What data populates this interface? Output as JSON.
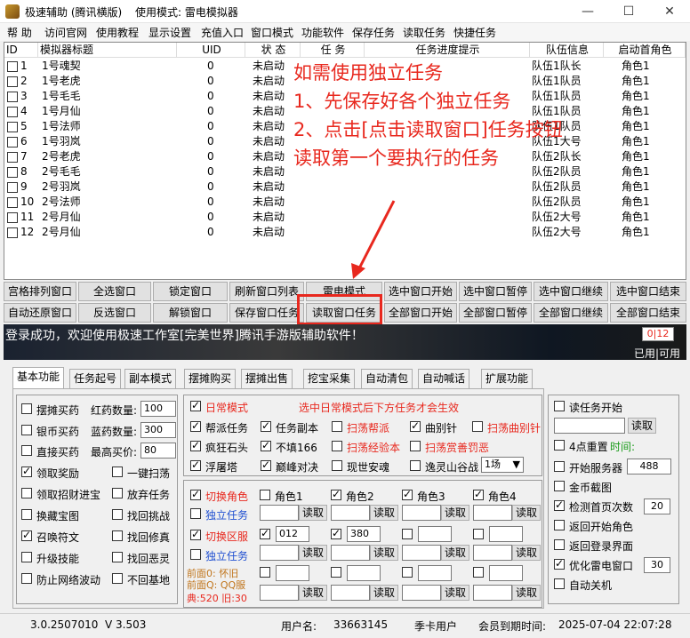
{
  "window": {
    "app_title": "极速辅助 (腾讯横版)",
    "mode_label": "使用模式: 雷电模拟器",
    "min": "—",
    "max": "☐",
    "close": "✕"
  },
  "menu": [
    "帮 助",
    "访问官网",
    "使用教程",
    "显示设置",
    "充值入口",
    "窗口模式",
    "功能软件",
    "保存任务",
    "读取任务",
    "快捷任务"
  ],
  "list": {
    "headers": [
      "ID",
      "模拟器标题",
      "UID",
      "状 态",
      "任 务",
      "任务进度提示",
      "队伍信息",
      "启动首角色"
    ],
    "rows": [
      {
        "id": "1",
        "title": "1号魂契",
        "uid": "0",
        "status": "未启动",
        "team": "队伍1队长",
        "role": "角色1"
      },
      {
        "id": "2",
        "title": "1号老虎",
        "uid": "0",
        "status": "未启动",
        "team": "队伍1队员",
        "role": "角色1"
      },
      {
        "id": "3",
        "title": "1号毛毛",
        "uid": "0",
        "status": "未启动",
        "team": "队伍1队员",
        "role": "角色1"
      },
      {
        "id": "4",
        "title": "1号月仙",
        "uid": "0",
        "status": "未启动",
        "team": "队伍1队员",
        "role": "角色1"
      },
      {
        "id": "5",
        "title": "1号法师",
        "uid": "0",
        "status": "未启动",
        "team": "队伍1队员",
        "role": "角色1"
      },
      {
        "id": "6",
        "title": "1号羽岚",
        "uid": "0",
        "status": "未启动",
        "team": "队伍1大号",
        "role": "角色1"
      },
      {
        "id": "7",
        "title": "2号老虎",
        "uid": "0",
        "status": "未启动",
        "team": "队伍2队长",
        "role": "角色1"
      },
      {
        "id": "8",
        "title": "2号毛毛",
        "uid": "0",
        "status": "未启动",
        "team": "队伍2队员",
        "role": "角色1"
      },
      {
        "id": "9",
        "title": "2号羽岚",
        "uid": "0",
        "status": "未启动",
        "team": "队伍2队员",
        "role": "角色1"
      },
      {
        "id": "10",
        "title": "2号法师",
        "uid": "0",
        "status": "未启动",
        "team": "队伍2队员",
        "role": "角色1"
      },
      {
        "id": "11",
        "title": "2号月仙",
        "uid": "0",
        "status": "未启动",
        "team": "队伍2大号",
        "role": "角色1"
      },
      {
        "id": "12",
        "title": "2号月仙",
        "uid": "0",
        "status": "未启动",
        "team": "队伍2大号",
        "role": "角色1"
      }
    ]
  },
  "overlay_text": [
    "如需使用独立任务",
    "1、先保存好各个独立任务",
    "2、点击[点击读取窗口]任务按钮",
    "读取第一个要执行的任务"
  ],
  "buttons_row1": [
    "宫格排列窗口",
    "全选窗口",
    "锁定窗口",
    "刷新窗口列表",
    "雷电模式",
    "选中窗口开始",
    "选中窗口暂停",
    "选中窗口继续",
    "选中窗口结束"
  ],
  "buttons_row2": [
    "自动还原窗口",
    "反选窗口",
    "解锁窗口",
    "保存窗口任务",
    "读取窗口任务",
    "全部窗口开始",
    "全部窗口暂停",
    "全部窗口继续",
    "全部窗口结束"
  ],
  "status": {
    "message": "登录成功，欢迎使用极速工作室[完美世界]腾讯手游版辅助软件！",
    "counter": "0|12",
    "used_available": "已用|可用"
  },
  "tabs": [
    "基本功能",
    "任务起号",
    "副本模式",
    "摆摊购买",
    "摆摊出售",
    "挖宝采集",
    "自动清包",
    "自动喊话",
    "扩展功能"
  ],
  "left_panel": {
    "items": [
      {
        "label": "摆摊买药",
        "checked": false
      },
      {
        "label": "银币买药",
        "checked": false
      },
      {
        "label": "直接买药",
        "checked": false
      },
      {
        "label": "领取奖励",
        "checked": true
      },
      {
        "label": "领取招财进宝",
        "checked": false
      },
      {
        "label": "换藏宝图",
        "checked": false
      },
      {
        "label": "召唤符文",
        "checked": true
      },
      {
        "label": "升级技能",
        "checked": false
      },
      {
        "label": "防止网络波动",
        "checked": false
      }
    ],
    "red_potion_label": "红药数量:",
    "red_potion_value": "100",
    "blue_potion_label": "蓝药数量:",
    "blue_potion_value": "300",
    "max_price_label": "最高买价:",
    "max_price_value": "80",
    "right_items": [
      {
        "label": "一键扫荡",
        "checked": false
      },
      {
        "label": "放弃任务",
        "checked": false
      },
      {
        "label": "找回挑战",
        "checked": false
      },
      {
        "label": "找回修真",
        "checked": false
      },
      {
        "label": "找回恶灵",
        "checked": false
      },
      {
        "label": "不回基地",
        "checked": false
      }
    ]
  },
  "daily_panel": {
    "daily_mode": "日常模式",
    "hint": "选中日常模式后下方任务才会生效",
    "tasks": [
      {
        "label": "帮派任务",
        "checked": true,
        "color": "black"
      },
      {
        "label": "任务副本",
        "checked": true,
        "color": "black"
      },
      {
        "label": "扫荡帮派",
        "checked": false,
        "color": "red"
      },
      {
        "label": "曲别针",
        "checked": true,
        "color": "black"
      },
      {
        "label": "扫荡曲别针",
        "checked": false,
        "color": "red"
      },
      {
        "label": "疯狂石头",
        "checked": true,
        "color": "black"
      },
      {
        "label": "不填166",
        "checked": true,
        "color": "black"
      },
      {
        "label": "扫荡经验本",
        "checked": false,
        "color": "red"
      },
      {
        "label": "扫荡赏善罚恶",
        "checked": false,
        "color": "red"
      },
      {
        "label": "浮屠塔",
        "checked": true,
        "color": "black"
      },
      {
        "label": "巅峰对决",
        "checked": true,
        "color": "black"
      },
      {
        "label": "现世安魂",
        "checked": false,
        "color": "black"
      },
      {
        "label": "逸灵山谷战",
        "checked": false,
        "color": "black"
      }
    ],
    "battle_select": "1场"
  },
  "role_panel": {
    "switch_role": "切换角色",
    "independent_task": "独立任务",
    "switch_server": "切换区服",
    "independent_task2": "独立任务",
    "roles": [
      {
        "label": "角色1",
        "checked": false
      },
      {
        "label": "角色2",
        "checked": true
      },
      {
        "label": "角色3",
        "checked": true
      },
      {
        "label": "角色4",
        "checked": true
      }
    ],
    "read_label": "读取",
    "server_values": [
      "012",
      "380"
    ],
    "front_0": "前面0: 怀旧",
    "front_q": "前面Q: QQ服",
    "dian": "典:520 旧:30"
  },
  "right_panel": {
    "read_task_start": "读任务开始",
    "read_btn": "读取",
    "reset_4": "4点重置",
    "time_label": "时间:",
    "start_server": "开始服务器",
    "start_server_value": "488",
    "coin_screenshot": "金币截图",
    "detect_home": "检测首页次数",
    "detect_home_value": "20",
    "return_start_role": "返回开始角色",
    "return_login": "返回登录界面",
    "optimize_leidian": "优化雷电窗口",
    "optimize_value": "30",
    "auto_shutdown": "自动关机"
  },
  "footer": {
    "version1": "3.0.2507010",
    "version2": "V 3.503",
    "username_label": "用户名:",
    "username": "33663145",
    "user_type": "季卡用户",
    "expire_label": "会员到期时间:",
    "expire": "2025-07-04 22:07:28"
  }
}
